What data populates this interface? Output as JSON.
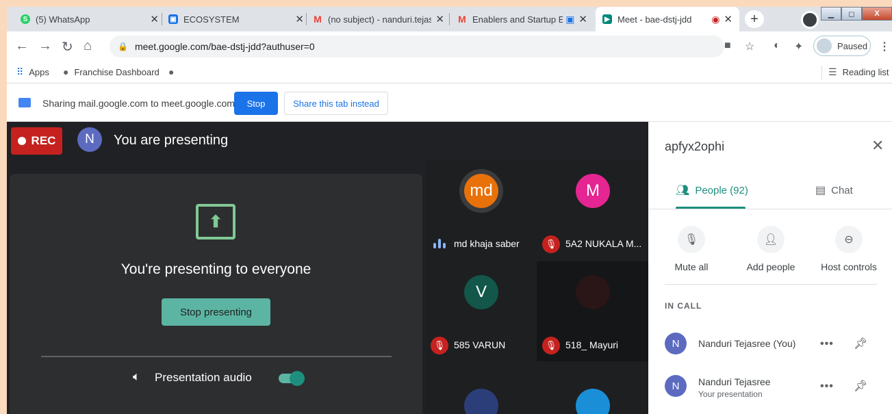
{
  "browser": {
    "tabs": [
      {
        "title": "(5) WhatsApp",
        "icon": "whatsapp-icon",
        "color": "#25d366"
      },
      {
        "title": "ECOSYSTEM",
        "icon": "document-icon",
        "color": "#1a73e8"
      },
      {
        "title": "(no subject) - nanduri.tejas",
        "icon": "gmail-icon",
        "color": "#ea4335"
      },
      {
        "title": "Enablers and Startup E",
        "icon": "gmail-icon",
        "color": "#ea4335"
      },
      {
        "title": "Meet - bae-dstj-jdd",
        "icon": "meet-icon",
        "color": "#00897b"
      }
    ],
    "url": "meet.google.com/bae-dstj-jdd?authuser=0",
    "profile_status": "Paused",
    "bookmarks": {
      "apps": "Apps",
      "franchise": "Franchise Dashboard",
      "reading_list": "Reading list"
    }
  },
  "sharebar": {
    "text": "Sharing mail.google.com to meet.google.com",
    "stop_label": "Stop",
    "share_tab_label": "Share this tab instead"
  },
  "meet": {
    "rec_label": "REC",
    "self_initial": "N",
    "presenting_label": "You are presenting",
    "present_message": "You're presenting to everyone",
    "stop_presenting_label": "Stop presenting",
    "audio_label": "Presentation audio",
    "participants": [
      {
        "initials": "md",
        "name": "md khaja saber",
        "color": "#e8710a",
        "muted": false
      },
      {
        "initials": "M",
        "name": "5A2 NUKALA M...",
        "color": "#e52592",
        "muted": true
      },
      {
        "initials": "V",
        "name": "585 VARUN",
        "color": "#12574a",
        "muted": true
      },
      {
        "initials": "",
        "name": "518_ Mayuri",
        "color": "#2a1517",
        "muted": true
      }
    ]
  },
  "side_panel": {
    "meeting_code": "apfyx2ophi",
    "people_tab": "People (92)",
    "chat_tab": "Chat",
    "actions": {
      "mute_all": "Mute all",
      "add_people": "Add people",
      "host_controls": "Host controls"
    },
    "section_label": "IN CALL",
    "people": [
      {
        "initial": "N",
        "name": "Nanduri Tejasree (You)",
        "sub": ""
      },
      {
        "initial": "N",
        "name": "Nanduri Tejasree",
        "sub": "Your presentation"
      }
    ]
  }
}
